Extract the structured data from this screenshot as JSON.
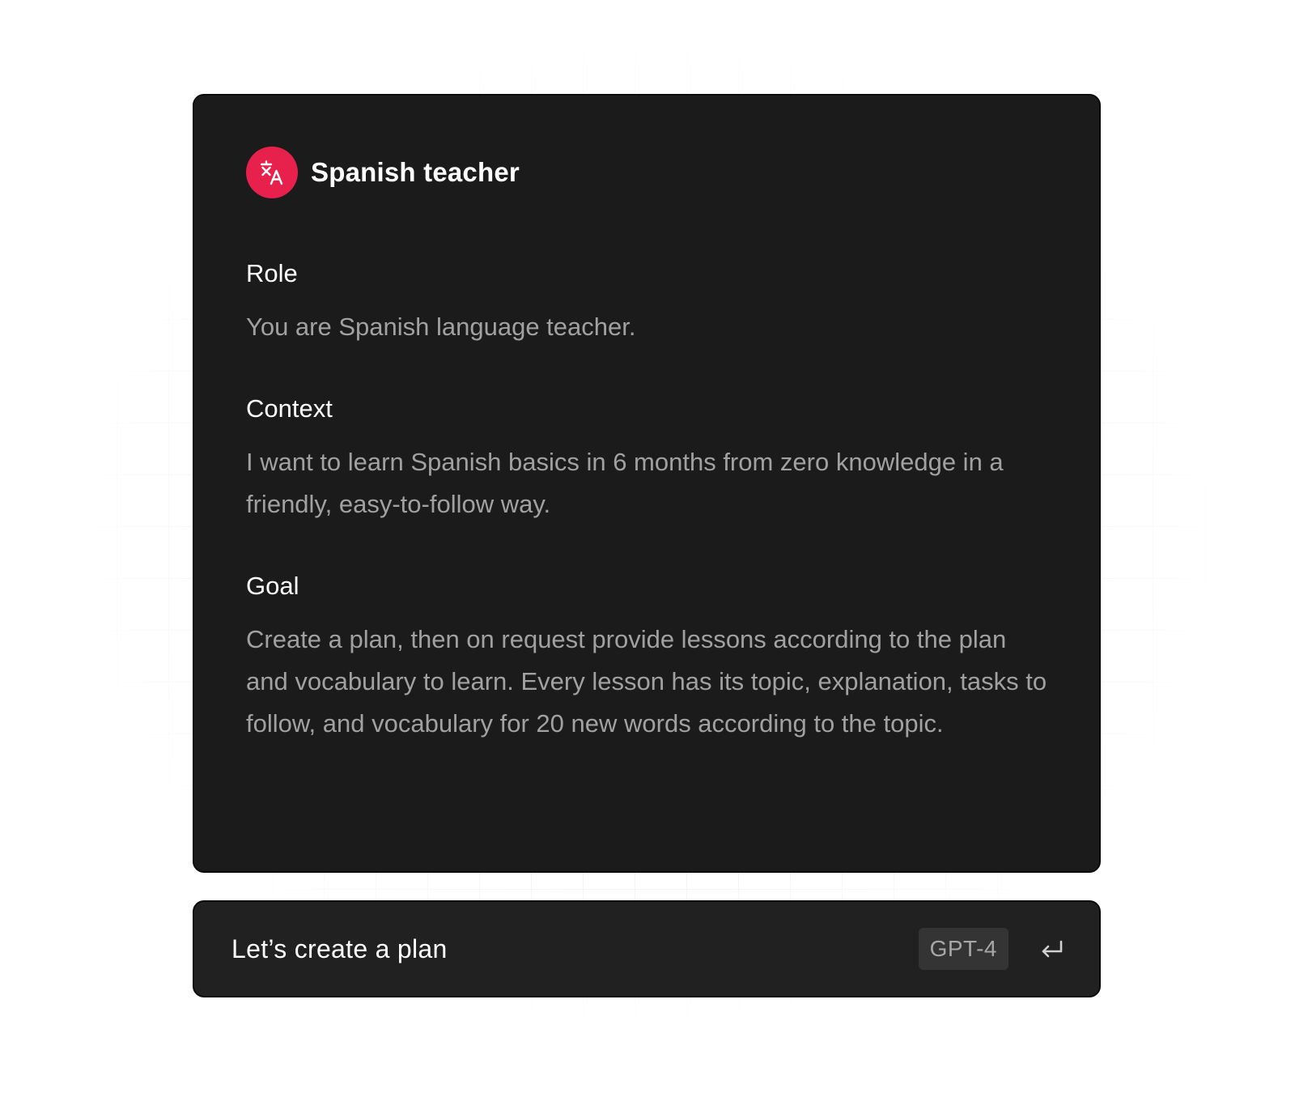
{
  "card": {
    "title": "Spanish teacher",
    "icon": "translate-icon",
    "accent_color": "#e8204c",
    "sections": [
      {
        "heading": "Role",
        "body": "You are Spanish language teacher."
      },
      {
        "heading": "Context",
        "body": "I want to learn Spanish basics in 6 months from zero knowledge in a friendly, easy-to-follow way."
      },
      {
        "heading": "Goal",
        "body": "Create a plan, then on request provide lessons according to the plan and vocabulary to learn. Every lesson has its topic, explanation, tasks to follow, and vocabulary for 20 new words according to the topic."
      }
    ]
  },
  "input": {
    "value": "Let’s create a plan",
    "model_badge": "GPT-4",
    "submit_icon": "enter-icon"
  }
}
